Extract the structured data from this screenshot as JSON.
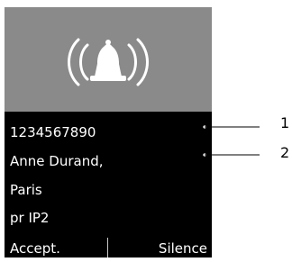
{
  "ringing_icon": "ringing-bell-icon",
  "caller": {
    "number": "1234567890",
    "name": "Anne Durand,",
    "city": "Paris",
    "line": "pr  IP2"
  },
  "softkeys": {
    "left": "Accept.",
    "right": "Silence"
  },
  "callouts": [
    "1",
    "2"
  ],
  "colors": {
    "icon_background": "#8a8a8a",
    "display_background": "#000000",
    "display_text": "#ffffff"
  }
}
